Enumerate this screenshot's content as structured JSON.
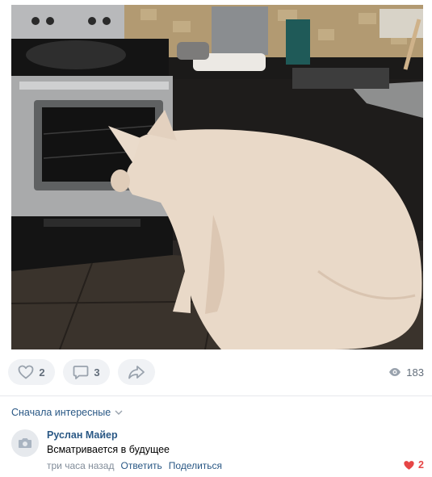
{
  "post": {
    "image_alt": "pig watching oven",
    "likes": "2",
    "comments": "3",
    "views": "183"
  },
  "sort": {
    "label": "Сначала интересные"
  },
  "comment": {
    "author": "Руслан Майер",
    "text": "Всматривается в будущее",
    "time": "три часа назад",
    "reply_label": "Ответить",
    "share_label": "Поделиться",
    "likes": "2"
  },
  "colors": {
    "link": "#2a5885",
    "muted": "#818c99",
    "like_red": "#e64646",
    "pill_bg": "#f0f2f5"
  },
  "icons": [
    "heart-icon",
    "comment-icon",
    "share-icon",
    "eye-icon",
    "chevron-down-icon",
    "camera-icon",
    "heart-filled-icon"
  ]
}
